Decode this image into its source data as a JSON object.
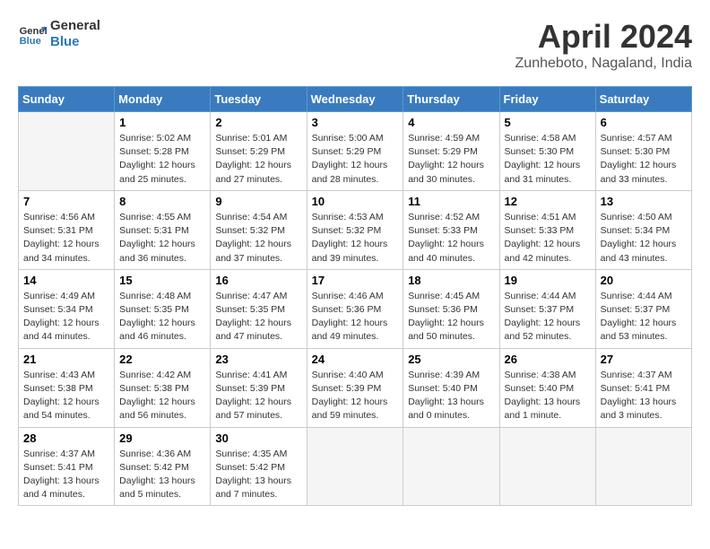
{
  "header": {
    "logo_line1": "General",
    "logo_line2": "Blue",
    "month": "April 2024",
    "location": "Zunheboto, Nagaland, India"
  },
  "columns": [
    "Sunday",
    "Monday",
    "Tuesday",
    "Wednesday",
    "Thursday",
    "Friday",
    "Saturday"
  ],
  "weeks": [
    [
      {
        "day": "",
        "info": ""
      },
      {
        "day": "1",
        "info": "Sunrise: 5:02 AM\nSunset: 5:28 PM\nDaylight: 12 hours\nand 25 minutes."
      },
      {
        "day": "2",
        "info": "Sunrise: 5:01 AM\nSunset: 5:29 PM\nDaylight: 12 hours\nand 27 minutes."
      },
      {
        "day": "3",
        "info": "Sunrise: 5:00 AM\nSunset: 5:29 PM\nDaylight: 12 hours\nand 28 minutes."
      },
      {
        "day": "4",
        "info": "Sunrise: 4:59 AM\nSunset: 5:29 PM\nDaylight: 12 hours\nand 30 minutes."
      },
      {
        "day": "5",
        "info": "Sunrise: 4:58 AM\nSunset: 5:30 PM\nDaylight: 12 hours\nand 31 minutes."
      },
      {
        "day": "6",
        "info": "Sunrise: 4:57 AM\nSunset: 5:30 PM\nDaylight: 12 hours\nand 33 minutes."
      }
    ],
    [
      {
        "day": "7",
        "info": "Sunrise: 4:56 AM\nSunset: 5:31 PM\nDaylight: 12 hours\nand 34 minutes."
      },
      {
        "day": "8",
        "info": "Sunrise: 4:55 AM\nSunset: 5:31 PM\nDaylight: 12 hours\nand 36 minutes."
      },
      {
        "day": "9",
        "info": "Sunrise: 4:54 AM\nSunset: 5:32 PM\nDaylight: 12 hours\nand 37 minutes."
      },
      {
        "day": "10",
        "info": "Sunrise: 4:53 AM\nSunset: 5:32 PM\nDaylight: 12 hours\nand 39 minutes."
      },
      {
        "day": "11",
        "info": "Sunrise: 4:52 AM\nSunset: 5:33 PM\nDaylight: 12 hours\nand 40 minutes."
      },
      {
        "day": "12",
        "info": "Sunrise: 4:51 AM\nSunset: 5:33 PM\nDaylight: 12 hours\nand 42 minutes."
      },
      {
        "day": "13",
        "info": "Sunrise: 4:50 AM\nSunset: 5:34 PM\nDaylight: 12 hours\nand 43 minutes."
      }
    ],
    [
      {
        "day": "14",
        "info": "Sunrise: 4:49 AM\nSunset: 5:34 PM\nDaylight: 12 hours\nand 44 minutes."
      },
      {
        "day": "15",
        "info": "Sunrise: 4:48 AM\nSunset: 5:35 PM\nDaylight: 12 hours\nand 46 minutes."
      },
      {
        "day": "16",
        "info": "Sunrise: 4:47 AM\nSunset: 5:35 PM\nDaylight: 12 hours\nand 47 minutes."
      },
      {
        "day": "17",
        "info": "Sunrise: 4:46 AM\nSunset: 5:36 PM\nDaylight: 12 hours\nand 49 minutes."
      },
      {
        "day": "18",
        "info": "Sunrise: 4:45 AM\nSunset: 5:36 PM\nDaylight: 12 hours\nand 50 minutes."
      },
      {
        "day": "19",
        "info": "Sunrise: 4:44 AM\nSunset: 5:37 PM\nDaylight: 12 hours\nand 52 minutes."
      },
      {
        "day": "20",
        "info": "Sunrise: 4:44 AM\nSunset: 5:37 PM\nDaylight: 12 hours\nand 53 minutes."
      }
    ],
    [
      {
        "day": "21",
        "info": "Sunrise: 4:43 AM\nSunset: 5:38 PM\nDaylight: 12 hours\nand 54 minutes."
      },
      {
        "day": "22",
        "info": "Sunrise: 4:42 AM\nSunset: 5:38 PM\nDaylight: 12 hours\nand 56 minutes."
      },
      {
        "day": "23",
        "info": "Sunrise: 4:41 AM\nSunset: 5:39 PM\nDaylight: 12 hours\nand 57 minutes."
      },
      {
        "day": "24",
        "info": "Sunrise: 4:40 AM\nSunset: 5:39 PM\nDaylight: 12 hours\nand 59 minutes."
      },
      {
        "day": "25",
        "info": "Sunrise: 4:39 AM\nSunset: 5:40 PM\nDaylight: 13 hours\nand 0 minutes."
      },
      {
        "day": "26",
        "info": "Sunrise: 4:38 AM\nSunset: 5:40 PM\nDaylight: 13 hours\nand 1 minute."
      },
      {
        "day": "27",
        "info": "Sunrise: 4:37 AM\nSunset: 5:41 PM\nDaylight: 13 hours\nand 3 minutes."
      }
    ],
    [
      {
        "day": "28",
        "info": "Sunrise: 4:37 AM\nSunset: 5:41 PM\nDaylight: 13 hours\nand 4 minutes."
      },
      {
        "day": "29",
        "info": "Sunrise: 4:36 AM\nSunset: 5:42 PM\nDaylight: 13 hours\nand 5 minutes."
      },
      {
        "day": "30",
        "info": "Sunrise: 4:35 AM\nSunset: 5:42 PM\nDaylight: 13 hours\nand 7 minutes."
      },
      {
        "day": "",
        "info": ""
      },
      {
        "day": "",
        "info": ""
      },
      {
        "day": "",
        "info": ""
      },
      {
        "day": "",
        "info": ""
      }
    ]
  ]
}
